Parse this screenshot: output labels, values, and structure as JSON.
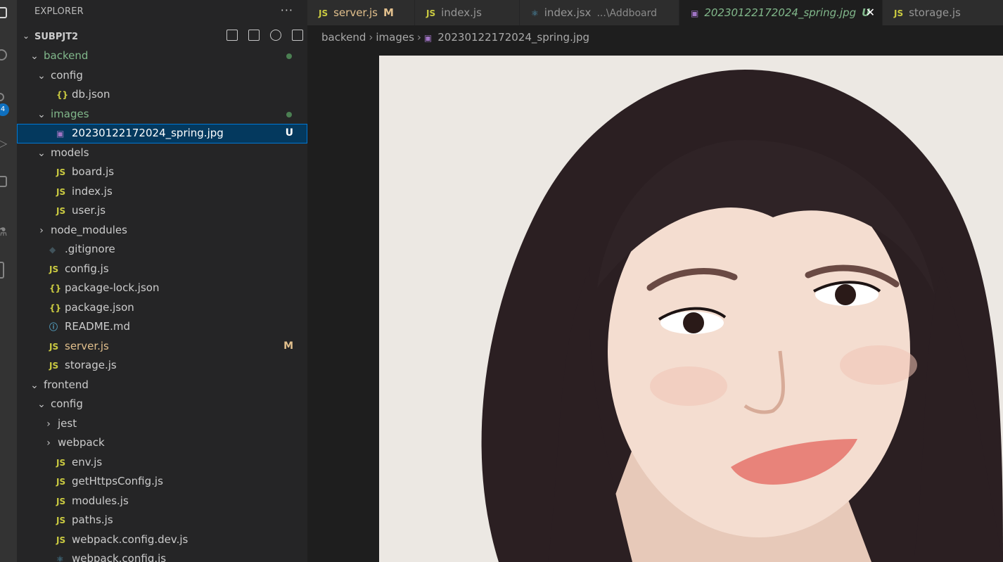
{
  "explorer": {
    "title": "EXPLORER",
    "more": "···",
    "workspace": "SUBPJT2"
  },
  "activity_bar": {
    "scm_badge": "4"
  },
  "tree": [
    {
      "label": "backend",
      "kind": "folder",
      "open": true,
      "depth": 1,
      "status": "dot"
    },
    {
      "label": "config",
      "kind": "folder",
      "open": true,
      "depth": 2
    },
    {
      "label": "db.json",
      "kind": "json",
      "depth": 3
    },
    {
      "label": "images",
      "kind": "folder",
      "open": true,
      "depth": 2,
      "status": "dot"
    },
    {
      "label": "20230122172024_spring.jpg",
      "kind": "image",
      "depth": 3,
      "badge": "U",
      "selected": true
    },
    {
      "label": "models",
      "kind": "folder",
      "open": true,
      "depth": 2
    },
    {
      "label": "board.js",
      "kind": "js",
      "depth": 3
    },
    {
      "label": "index.js",
      "kind": "js",
      "depth": 3
    },
    {
      "label": "user.js",
      "kind": "js",
      "depth": 3
    },
    {
      "label": "node_modules",
      "kind": "folder",
      "open": false,
      "depth": 2
    },
    {
      "label": ".gitignore",
      "kind": "git",
      "depth": 2
    },
    {
      "label": "config.js",
      "kind": "js",
      "depth": 2
    },
    {
      "label": "package-lock.json",
      "kind": "json",
      "depth": 2
    },
    {
      "label": "package.json",
      "kind": "json",
      "depth": 2
    },
    {
      "label": "README.md",
      "kind": "info",
      "depth": 2
    },
    {
      "label": "server.js",
      "kind": "js",
      "depth": 2,
      "badge": "M"
    },
    {
      "label": "storage.js",
      "kind": "js",
      "depth": 2
    },
    {
      "label": "frontend",
      "kind": "folder",
      "open": true,
      "depth": 1
    },
    {
      "label": "config",
      "kind": "folder",
      "open": true,
      "depth": 2
    },
    {
      "label": "jest",
      "kind": "folder",
      "open": false,
      "depth": 3
    },
    {
      "label": "webpack",
      "kind": "folder",
      "open": false,
      "depth": 3
    },
    {
      "label": "env.js",
      "kind": "js",
      "depth": 3
    },
    {
      "label": "getHttpsConfig.js",
      "kind": "js",
      "depth": 3
    },
    {
      "label": "modules.js",
      "kind": "js",
      "depth": 3
    },
    {
      "label": "paths.js",
      "kind": "js",
      "depth": 3
    },
    {
      "label": "webpack.config.dev.js",
      "kind": "js",
      "depth": 3
    },
    {
      "label": "webpack.config.js",
      "kind": "react",
      "depth": 3
    }
  ],
  "icons": {
    "js": "JS",
    "json": "{}",
    "image": "▣",
    "git": "◆",
    "info": "ⓘ",
    "react": "⚛",
    "open": "⌄",
    "closed": "›"
  },
  "tabs": [
    {
      "label": "server.js",
      "icon": "JS",
      "status": "M",
      "description": ""
    },
    {
      "label": "index.js",
      "icon": "JS",
      "status": "",
      "description": ""
    },
    {
      "label": "index.jsx",
      "icon": "⚛",
      "status": "",
      "description": "...\\Addboard"
    },
    {
      "label": "20230122172024_spring.jpg",
      "icon": "▣",
      "status": "U",
      "description": "",
      "active": true,
      "close": "✕"
    },
    {
      "label": "storage.js",
      "icon": "JS",
      "status": "",
      "description": ""
    }
  ],
  "breadcrumb": {
    "parts": [
      "backend",
      "images"
    ],
    "file": "20230122172024_spring.jpg",
    "separator": "›"
  },
  "colors": {
    "accent": "#0078d4",
    "untracked": "#81b88b",
    "modified": "#e2c08d",
    "js_icon": "#cbcb41",
    "image_icon": "#a074c4"
  }
}
